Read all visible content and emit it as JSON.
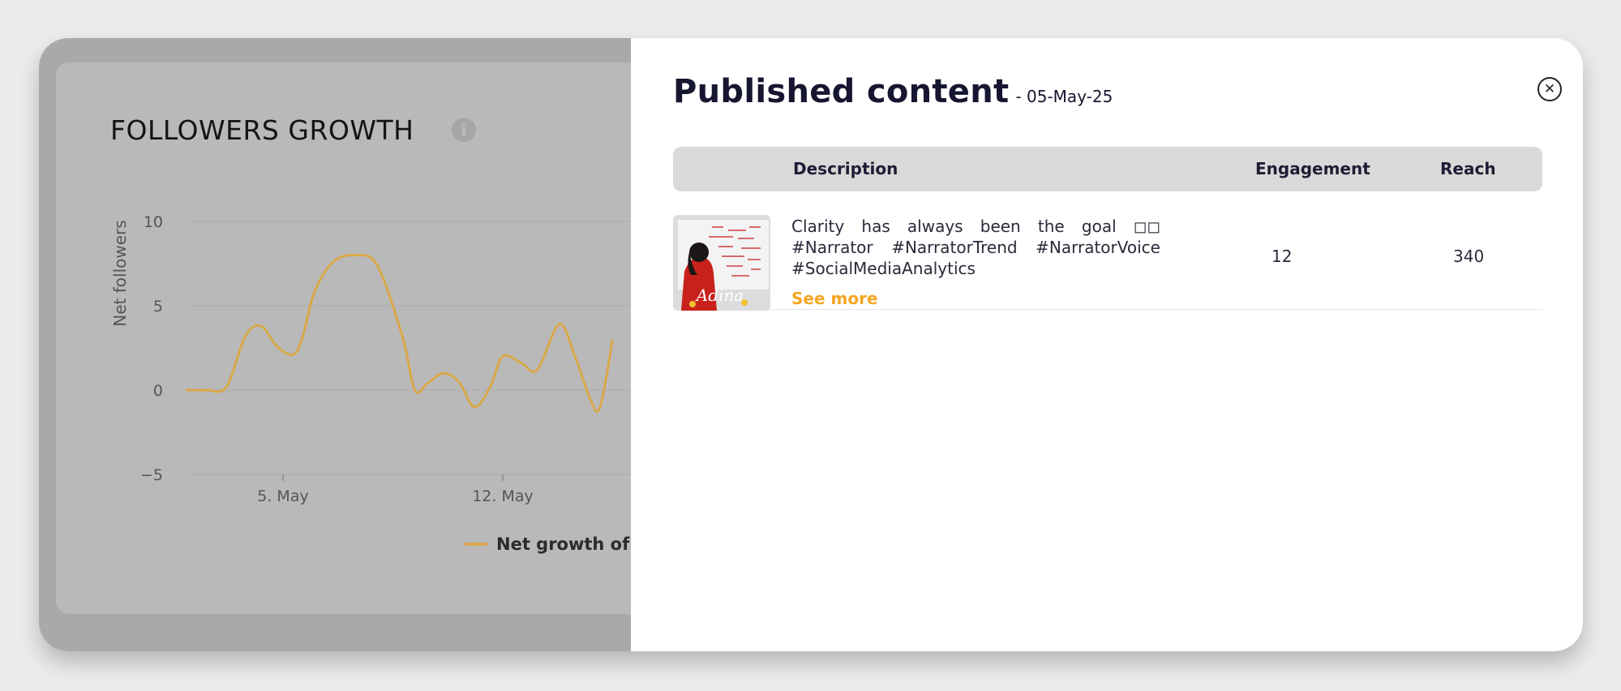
{
  "followers_panel": {
    "title": "FOLLOWERS GROWTH",
    "info_icon": "info-circle-icon",
    "legend_label": "Net growth of",
    "line_color": "#d9a84a"
  },
  "chart_data": {
    "type": "line",
    "ylabel": "Net followers",
    "xlabel": "",
    "ylim": [
      -5,
      10
    ],
    "yticks": [
      "10",
      "5",
      "0",
      "−5"
    ],
    "yticks_values": [
      10,
      5,
      0,
      -5
    ],
    "xtick_labels": [
      "5. May",
      "12. May"
    ],
    "xtick_days": [
      5,
      12
    ],
    "grid": true,
    "series": [
      {
        "name": "Net growth of",
        "x": [
          1.9,
          2.3,
          2.6,
          3.2,
          3.8,
          4.3,
          4.8,
          5.3,
          5.6,
          6.0,
          6.6,
          7.3,
          8.0,
          8.8,
          9.2,
          9.6,
          10.1,
          10.6,
          11.1,
          11.6,
          12.0,
          12.6,
          13.1,
          13.8,
          14.3,
          14.8,
          15.1,
          15.5
        ],
        "y": [
          0,
          0,
          0,
          0.2,
          3.2,
          3.8,
          2.6,
          2.1,
          3.0,
          5.8,
          7.6,
          8.0,
          7.4,
          3.2,
          0.0,
          0.4,
          1.0,
          0.5,
          -1.0,
          0.2,
          2.0,
          1.6,
          1.2,
          3.9,
          2.0,
          -0.6,
          -1.0,
          3.0
        ]
      }
    ]
  },
  "modal": {
    "title": "Published content",
    "date": "- 05-May-25",
    "close_icon": "close-circle-icon",
    "columns": {
      "description": "Description",
      "engagement": "Engagement",
      "reach": "Reach"
    },
    "rows": [
      {
        "thumbnail_icon": "post-thumbnail-image",
        "thumbnail_text": "Adina",
        "description": "Clarity has always been the goal ◻◻ #Narrator #NarratorTrend #NarratorVoice #SocialMediaAnalytics",
        "see_more": "See more",
        "engagement": "12",
        "reach": "340"
      }
    ]
  }
}
